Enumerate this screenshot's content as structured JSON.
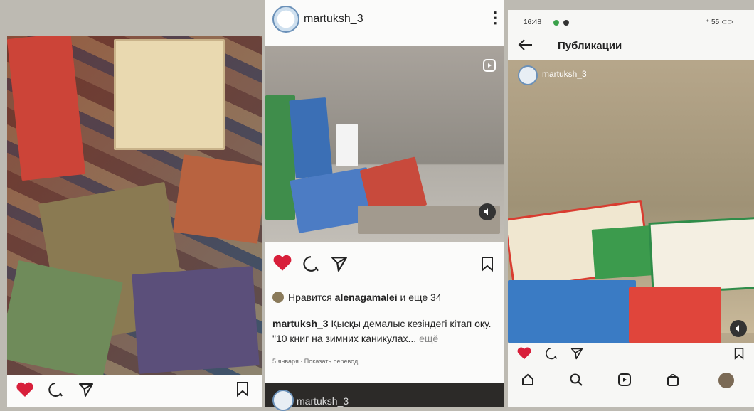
{
  "left_post": {},
  "middle_post": {
    "username": "martuksh_3",
    "menu_glyph": "⋮",
    "likes_prefix": "Нравится",
    "likes_user": "alenagamalei",
    "likes_suffix": "и еще 34",
    "caption_user": "martuksh_3",
    "caption_text": "Қысқы демалыс кезіндегі кітап оқу.",
    "caption_line2": "\"10 книг на зимних каникулах...",
    "caption_more": "ещё",
    "date_text": "5 января · Показать перевод",
    "next_post_username": "martuksh_3"
  },
  "right_phone": {
    "time": "16:48",
    "status_right": "⁺ 55 ⊂⊃",
    "header_title": "Публикации",
    "post_username": "martuksh_3"
  },
  "colors": {
    "like_red": "#d81f3a",
    "icon_dark": "#222222"
  }
}
